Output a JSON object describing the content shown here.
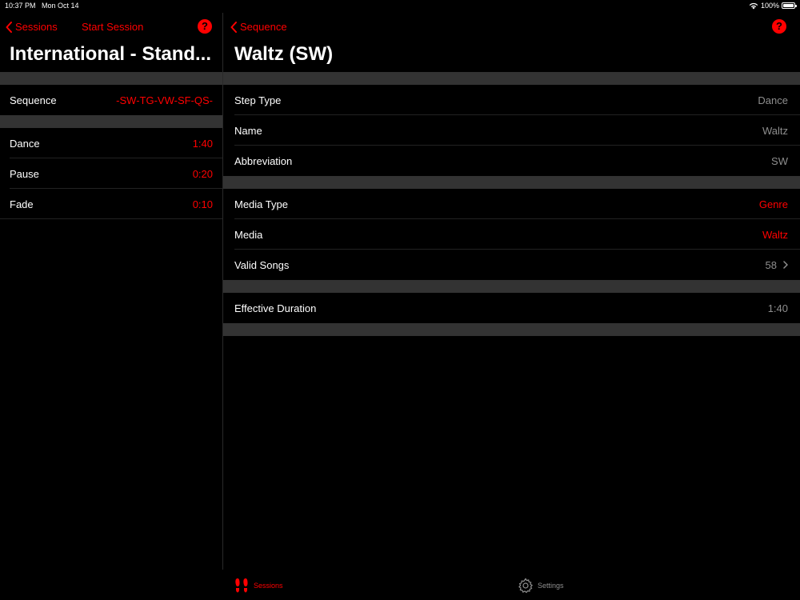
{
  "status": {
    "time": "10:37 PM",
    "date": "Mon Oct 14",
    "battery": "100%"
  },
  "left": {
    "back_label": "Sessions",
    "action_label": "Start Session",
    "help": "?",
    "title": "International - Stand...",
    "sequence": {
      "label": "Sequence",
      "value": "-SW-TG-VW-SF-QS-"
    },
    "timings": [
      {
        "label": "Dance",
        "value": "1:40"
      },
      {
        "label": "Pause",
        "value": "0:20"
      },
      {
        "label": "Fade",
        "value": "0:10"
      }
    ]
  },
  "right": {
    "back_label": "Sequence",
    "help": "?",
    "title": "Waltz (SW)",
    "details": [
      {
        "label": "Step Type",
        "value": "Dance"
      },
      {
        "label": "Name",
        "value": "Waltz"
      },
      {
        "label": "Abbreviation",
        "value": "SW"
      }
    ],
    "media": [
      {
        "label": "Media Type",
        "value": "Genre"
      },
      {
        "label": "Media",
        "value": "Waltz"
      },
      {
        "label": "Valid Songs",
        "value": "58"
      }
    ],
    "duration": {
      "label": "Effective Duration",
      "value": "1:40"
    }
  },
  "tabs": {
    "sessions": "Sessions",
    "settings": "Settings"
  },
  "colors": {
    "accent": "#ff0000",
    "background": "#000000",
    "separator": "#333333"
  },
  "icons": {
    "back": "chevron-left-icon",
    "help": "question-icon",
    "sessions": "footprints-icon",
    "settings": "gear-icon",
    "disclosure": "chevron-right-icon"
  }
}
